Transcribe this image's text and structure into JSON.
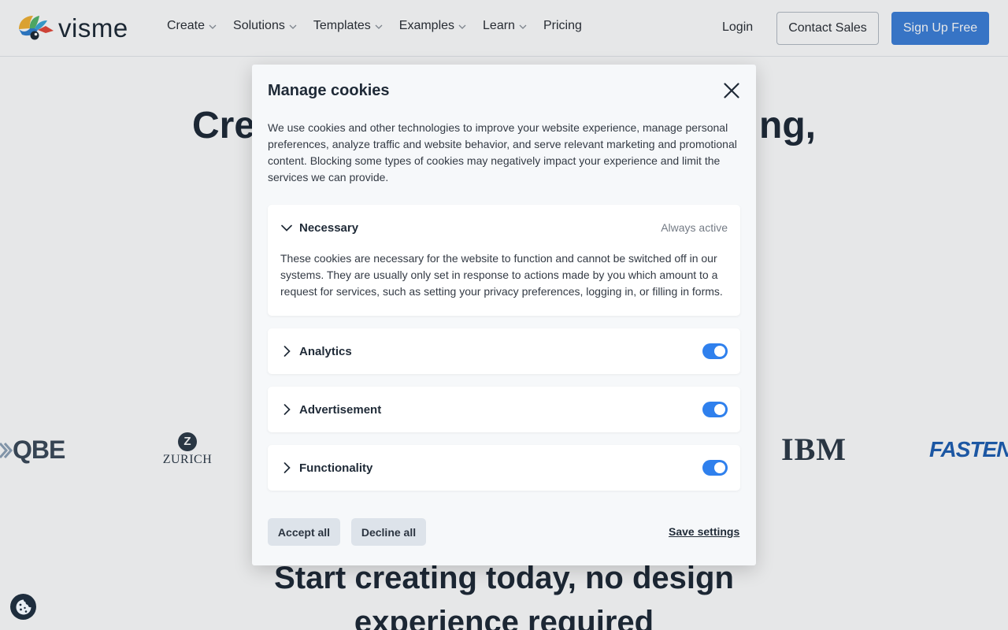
{
  "header": {
    "logo_text": "visme",
    "nav": [
      {
        "label": "Create",
        "has_dropdown": true
      },
      {
        "label": "Solutions",
        "has_dropdown": true
      },
      {
        "label": "Templates",
        "has_dropdown": true
      },
      {
        "label": "Examples",
        "has_dropdown": true
      },
      {
        "label": "Learn",
        "has_dropdown": true
      },
      {
        "label": "Pricing",
        "has_dropdown": false
      }
    ],
    "login_label": "Login",
    "contact_label": "Contact Sales",
    "signup_label": "Sign Up Free"
  },
  "hero": {
    "title_left": "Cre",
    "title_right": "ng,"
  },
  "logos": {
    "qbe": "QBE",
    "zurich_mark": "Z",
    "zurich": "ZURICH",
    "ibm": "IBM",
    "fastenal": "FASTENAL"
  },
  "cta": {
    "title_line1": "Start creating today, no design",
    "title_line2": "experience required"
  },
  "cookie_modal": {
    "title": "Manage cookies",
    "description": "We use cookies and other technologies to improve your website experience, manage personal preferences, analyze traffic and website behavior, and serve relevant marketing and promotional content. Blocking some types of cookies may negatively impact your experience and limit the services we can provide.",
    "categories": [
      {
        "label": "Necessary",
        "status": "Always active",
        "expanded": true,
        "description": "These cookies are necessary for the website to function and cannot be switched off in our systems. They are usually only set in response to actions made by you which amount to a request for services, such as setting your privacy preferences, logging in, or filling in forms."
      },
      {
        "label": "Analytics",
        "enabled": true,
        "expanded": false
      },
      {
        "label": "Advertisement",
        "enabled": true,
        "expanded": false
      },
      {
        "label": "Functionality",
        "enabled": true,
        "expanded": false
      }
    ],
    "accept_label": "Accept all",
    "decline_label": "Decline all",
    "save_label": "Save settings"
  },
  "colors": {
    "primary": "#3d7fd9",
    "toggle_on": "#2f80ed",
    "text_dark": "#1f2a37",
    "modal_bg": "#f6f8fa",
    "button_grey": "#dde3ea",
    "fab_bg": "#1e2d3d"
  },
  "icons": {
    "close": "close-icon",
    "chevron_down": "chevron-down-icon",
    "chevron_right": "chevron-right-icon",
    "cookie": "cookie-icon"
  }
}
